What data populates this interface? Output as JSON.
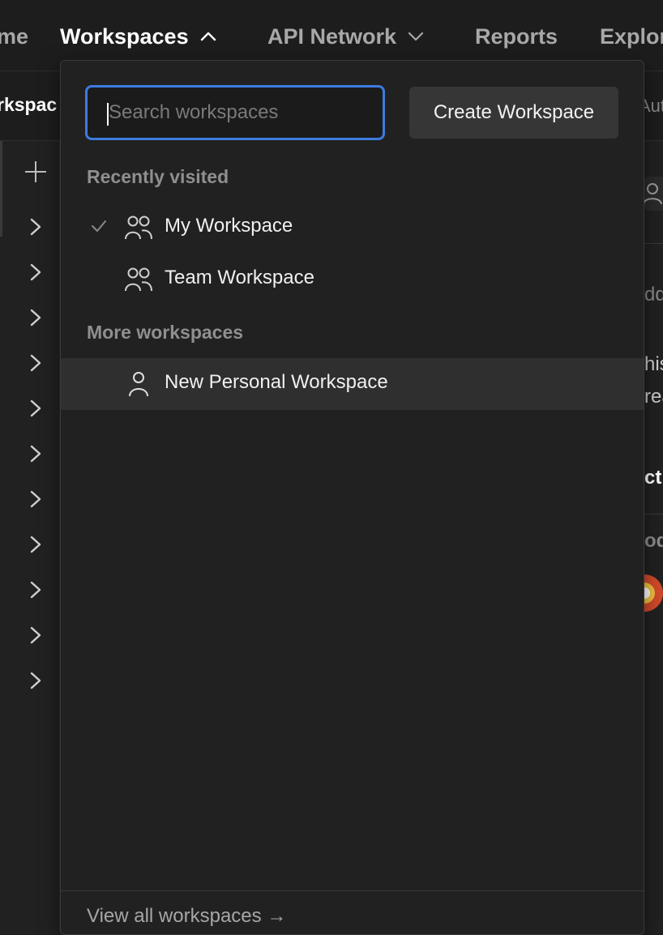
{
  "nav": {
    "items": [
      {
        "label": "me",
        "active": false
      },
      {
        "label": "Workspaces",
        "active": true
      },
      {
        "label": "API Network",
        "active": false
      },
      {
        "label": "Reports",
        "active": false
      },
      {
        "label": "Explor",
        "active": false
      }
    ]
  },
  "background": {
    "subbar_title": "rkspac",
    "subbar_right": "Aut",
    "right_edge_fragments": [
      "dd",
      "his",
      "rea",
      "cti",
      "oda"
    ]
  },
  "dropdown": {
    "search": {
      "placeholder": "Search workspaces",
      "value": ""
    },
    "create_label": "Create Workspace",
    "recent_label": "Recently visited",
    "recent": [
      {
        "label": "My Workspace",
        "checked": true,
        "icon": "team-icon"
      },
      {
        "label": "Team Workspace",
        "checked": false,
        "icon": "team-icon"
      }
    ],
    "more_label": "More workspaces",
    "more": [
      {
        "label": "New Personal Workspace",
        "icon": "person-icon"
      }
    ],
    "view_all_label": "View all workspaces →"
  },
  "colors": {
    "accent": "#3d7be0",
    "panel_bg": "#212121",
    "nav_bg": "#1d1d1d",
    "hover_row": "#2f2f2f"
  }
}
